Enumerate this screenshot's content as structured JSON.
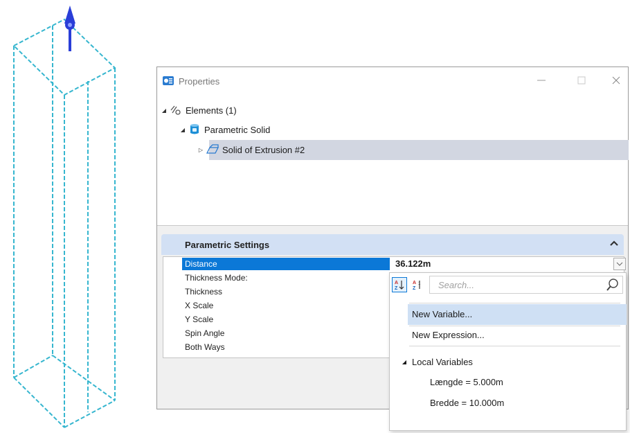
{
  "window": {
    "title": "Properties",
    "controls": {
      "minimize": "—",
      "maximize": "☐",
      "close": "✕"
    }
  },
  "tree": {
    "root": {
      "label": "Elements (1)",
      "icon": "elements-icon",
      "expanded": true
    },
    "child": {
      "label": "Parametric Solid",
      "icon": "parametric-solid-icon",
      "expanded": true
    },
    "grandchild": {
      "label": "Solid of Extrusion #2",
      "icon": "extrusion-icon",
      "expanded": false,
      "selected": true
    }
  },
  "parametric_settings": {
    "header": "Parametric Settings",
    "rows": [
      {
        "name": "Distance",
        "value": "36.122m",
        "selected": true
      },
      {
        "name": "Thickness Mode:",
        "value": ""
      },
      {
        "name": "Thickness",
        "value": ""
      },
      {
        "name": "X Scale",
        "value": ""
      },
      {
        "name": "Y Scale",
        "value": ""
      },
      {
        "name": "Spin Angle",
        "value": ""
      },
      {
        "name": "Both Ways",
        "value": ""
      }
    ]
  },
  "dropdown": {
    "sort_az_icon": "sort-ascending-icon",
    "sort_za_icon": "sort-descending-icon",
    "search_placeholder": "Search...",
    "items": [
      "New Variable...",
      "New Expression..."
    ],
    "highlighted_item": "New Variable...",
    "group": {
      "label": "Local Variables",
      "variables": [
        "Længde = 5.000m",
        "Bredde = 10.000m"
      ]
    }
  },
  "colors": {
    "selection_blue": "#0b78d7",
    "tree_selection": "#d2d6e1",
    "header_bg": "#d2e0f4",
    "wireframe": "#36b6cf",
    "manipulator": "#2a3ed8"
  }
}
